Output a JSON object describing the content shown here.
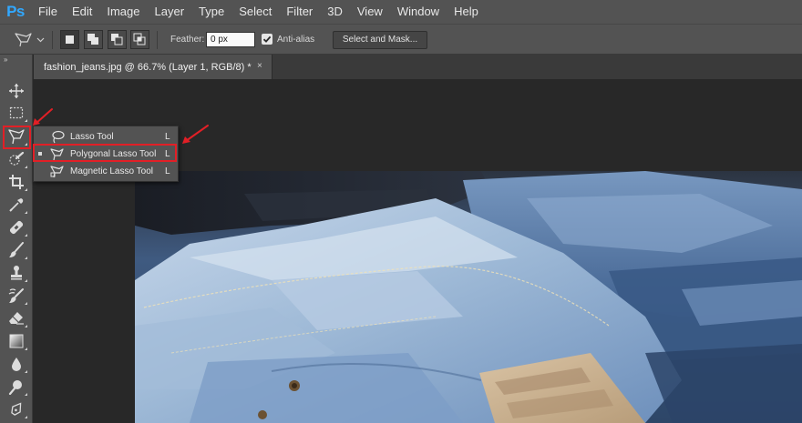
{
  "app": {
    "logo_text": "Ps",
    "logo_color": "#31a8ff"
  },
  "menu": [
    "File",
    "Edit",
    "Image",
    "Layer",
    "Type",
    "Select",
    "Filter",
    "3D",
    "View",
    "Window",
    "Help"
  ],
  "options": {
    "feather_label": "Feather:",
    "feather_value": "0 px",
    "antialias_label": "Anti-alias",
    "antialias_checked": true,
    "select_mask_label": "Select and Mask...",
    "selection_modes": [
      "new-selection-icon",
      "add-to-selection-icon",
      "subtract-from-selection-icon",
      "intersect-selection-icon"
    ]
  },
  "document_tab": {
    "title": "fashion_jeans.jpg @ 66.7% (Layer 1, RGB/8) *",
    "close": "×"
  },
  "toolbar": {
    "collapse_glyph": "»",
    "tools": [
      "move-tool-icon",
      "marquee-tool-icon",
      "lasso-tool-icon",
      "quick-selection-tool-icon",
      "crop-tool-icon",
      "eyedropper-tool-icon",
      "healing-brush-tool-icon",
      "brush-tool-icon",
      "clone-stamp-tool-icon",
      "history-brush-tool-icon",
      "eraser-tool-icon",
      "gradient-tool-icon",
      "blur-tool-icon",
      "dodge-tool-icon",
      "pen-tool-icon"
    ]
  },
  "flyout": {
    "items": [
      {
        "label": "Lasso Tool",
        "key": "L",
        "selected": false
      },
      {
        "label": "Polygonal Lasso Tool",
        "key": "L",
        "selected": true
      },
      {
        "label": "Magnetic Lasso Tool",
        "key": "L",
        "selected": false
      }
    ]
  },
  "colors": {
    "highlight": "#e21f26",
    "ui_panel": "#535353",
    "canvas": "#282828"
  }
}
